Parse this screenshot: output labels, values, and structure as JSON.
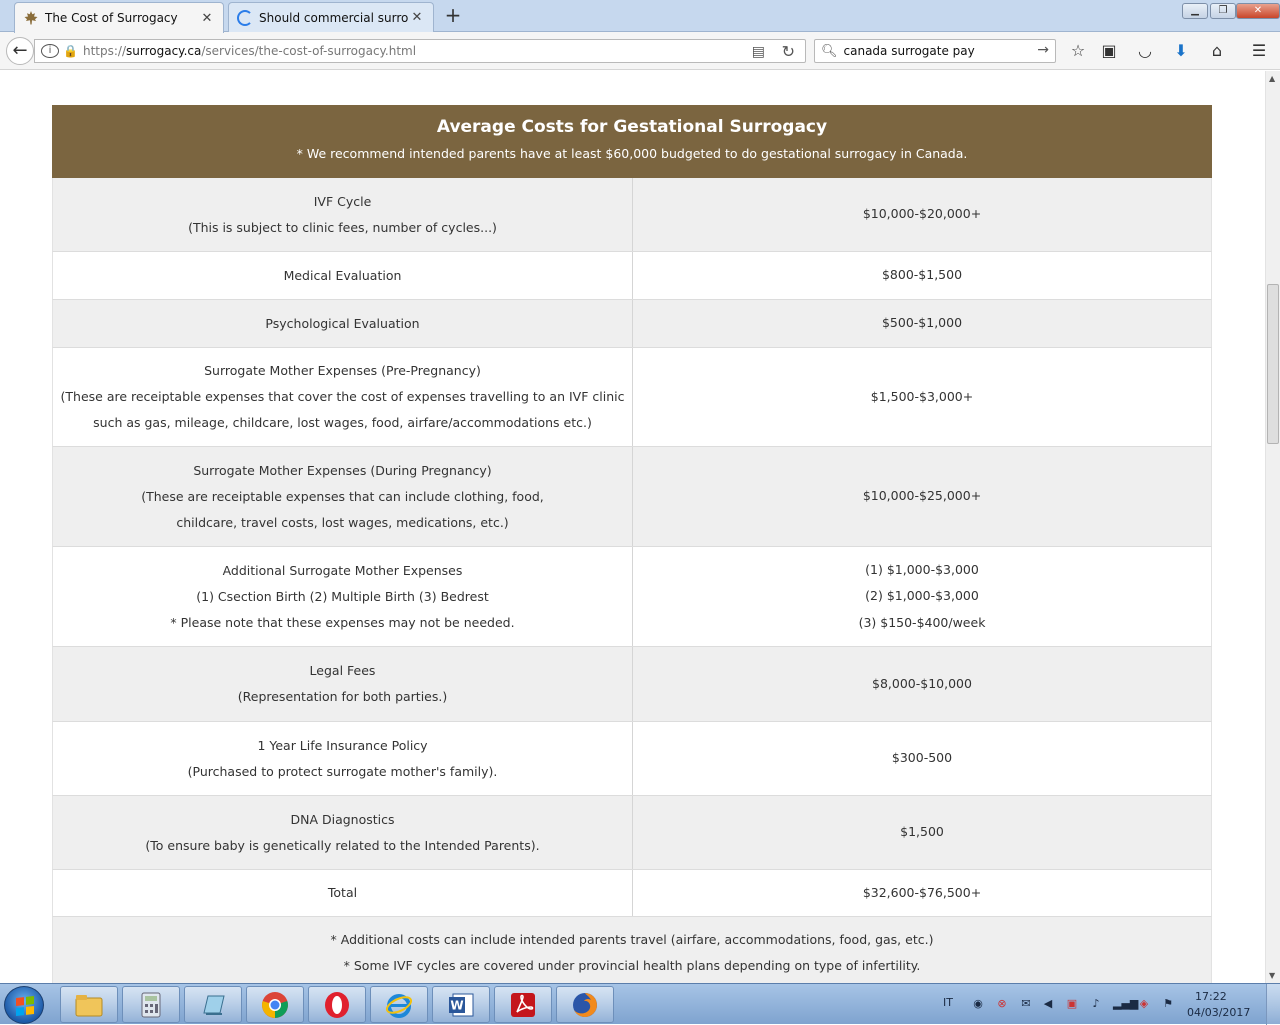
{
  "browser": {
    "tabs": [
      {
        "title": "The Cost of Surrogacy",
        "favicon": "maple-leaf-icon",
        "active": true
      },
      {
        "title": "Should commercial surrog...",
        "favicon": "loading-spinner-icon",
        "active": false
      }
    ],
    "url_prefix": "https://",
    "url_domain": "surrogacy.ca",
    "url_path": "/services/the-cost-of-surrogacy.html",
    "search_value": "canada surrogate pay",
    "search_placeholder": "Search"
  },
  "page": {
    "table_title": "Average Costs for Gestational Surrogacy",
    "table_note": "* We recommend intended parents have at least $60,000 budgeted to do gestational surrogacy in Canada.",
    "rows": [
      {
        "item": [
          "IVF Cycle",
          "(This is subject to clinic fees, number of cycles...)"
        ],
        "cost": [
          "$10,000-$20,000+"
        ]
      },
      {
        "item": [
          "Medical Evaluation"
        ],
        "cost": [
          "$800-$1,500"
        ]
      },
      {
        "item": [
          "Psychological Evaluation"
        ],
        "cost": [
          "$500-$1,000"
        ]
      },
      {
        "item": [
          "Surrogate Mother Expenses (Pre-Pregnancy)",
          "(These are receiptable expenses that cover the cost of expenses travelling to an IVF clinic",
          "such as gas, mileage, childcare, lost wages, food, airfare/accommodations etc.)"
        ],
        "cost": [
          "$1,500-$3,000+"
        ]
      },
      {
        "item": [
          "Surrogate Mother Expenses (During Pregnancy)",
          "(These are receiptable expenses that can include clothing, food,",
          "childcare, travel costs, lost wages, medications, etc.)"
        ],
        "cost": [
          "$10,000-$25,000+"
        ]
      },
      {
        "item": [
          "Additional Surrogate Mother Expenses",
          "(1) Csection Birth (2) Multiple Birth (3) Bedrest",
          "* Please note that these expenses may not be needed."
        ],
        "cost": [
          "(1) $1,000-$3,000",
          "(2) $1,000-$3,000",
          "(3) $150-$400/week"
        ]
      },
      {
        "item": [
          "Legal Fees",
          "(Representation for both parties.)"
        ],
        "cost": [
          "$8,000-$10,000"
        ]
      },
      {
        "item": [
          "1 Year Life Insurance Policy",
          "(Purchased to protect surrogate mother's family)."
        ],
        "cost": [
          "$300-500"
        ]
      },
      {
        "item": [
          "DNA Diagnostics",
          "(To ensure baby is genetically related to the Intended Parents)."
        ],
        "cost": [
          "$1,500"
        ]
      },
      {
        "item": [
          "Total"
        ],
        "cost": [
          "$32,600-$76,500+"
        ]
      }
    ],
    "footnotes": [
      "* Additional costs can include intended parents travel (airfare, accommodations, food, gas, etc.)",
      "* Some IVF cycles are covered under provincial health plans depending on type of infertility."
    ]
  },
  "taskbar": {
    "apps": [
      "file-explorer-icon",
      "calculator-icon",
      "notepad-icon",
      "chrome-icon",
      "opera-icon",
      "internet-explorer-icon",
      "word-icon",
      "acrobat-icon",
      "firefox-icon"
    ],
    "language": "IT",
    "time": "17:22",
    "date": "04/03/2017"
  },
  "colors": {
    "header_brown": "#7b6540",
    "row_gray": "#efefef"
  }
}
